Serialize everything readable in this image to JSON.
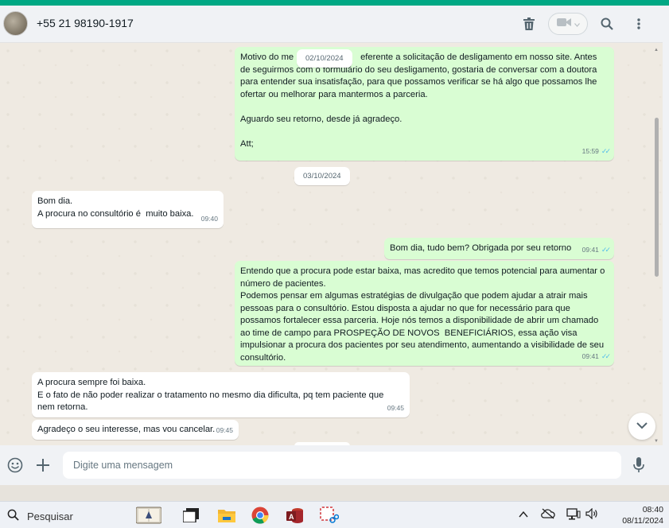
{
  "header": {
    "contact_name": "+55 21 98190-1917",
    "icons": [
      "trash-icon",
      "video-call-icon",
      "search-icon",
      "menu-dots-icon"
    ]
  },
  "chat": {
    "floating_date": "02/10/2024",
    "messages": [
      {
        "direction": "out",
        "text": "Motivo do me                           eferente a solicitação de desligamento em nosso site. Antes de seguirmos com o formulário do seu desligamento, gostaria de conversar com a doutora para entender sua insatisfação, para que possamos verificar se há algo que possamos lhe ofertar ou melhorar para mantermos a parceria.\n\nAguardo seu retorno, desde já agradeço.\n\nAtt;",
        "time": "15:59"
      },
      {
        "direction": "date",
        "text": "03/10/2024"
      },
      {
        "direction": "in",
        "text": "Bom dia.\nA procura no consultório é  muito baixa.",
        "time": "09:40"
      },
      {
        "direction": "out",
        "text": "Bom dia, tudo bem? Obrigada por seu retorno",
        "time": "09:41"
      },
      {
        "direction": "out",
        "text": "Entendo que a procura pode estar baixa, mas acredito que temos potencial para aumentar o número de pacientes.\nPodemos pensar em algumas estratégias de divulgação que podem ajudar a atrair mais pessoas para o consultório. Estou disposta a ajudar no que for necessário para que possamos fortalecer essa parceria. Hoje nós temos a disponibilidade de abrir um chamado ao time de campo para PROSPEÇÃO DE NOVOS  BENEFICIÁRIOS, essa ação visa impulsionar a procura dos pacientes por seu atendimento, aumentando a visibilidade de seu consultório.",
        "time": "09:41"
      },
      {
        "direction": "in",
        "text": "A procura sempre foi baixa.\nE o fato de não poder realizar o tratamento no mesmo dia dificulta, pq tem paciente que nem retorna.",
        "time": "09:45"
      },
      {
        "direction": "in",
        "text": "Agradeço o seu interesse, mas vou cancelar.",
        "time": "09:45"
      }
    ]
  },
  "footer": {
    "input_placeholder": "Digite uma mensagem",
    "icons": [
      "emoji-icon",
      "attach-plus-icon",
      "microphone-icon"
    ]
  },
  "taskbar": {
    "search_label": "Pesquisar",
    "time": "08:40",
    "date": "08/11/2024"
  },
  "colors": {
    "accent": "#00a884",
    "outgoing_bubble": "#d9fdd3",
    "incoming_bubble": "#ffffff",
    "chat_bg": "#efeae2",
    "read_ticks": "#53bdeb"
  }
}
